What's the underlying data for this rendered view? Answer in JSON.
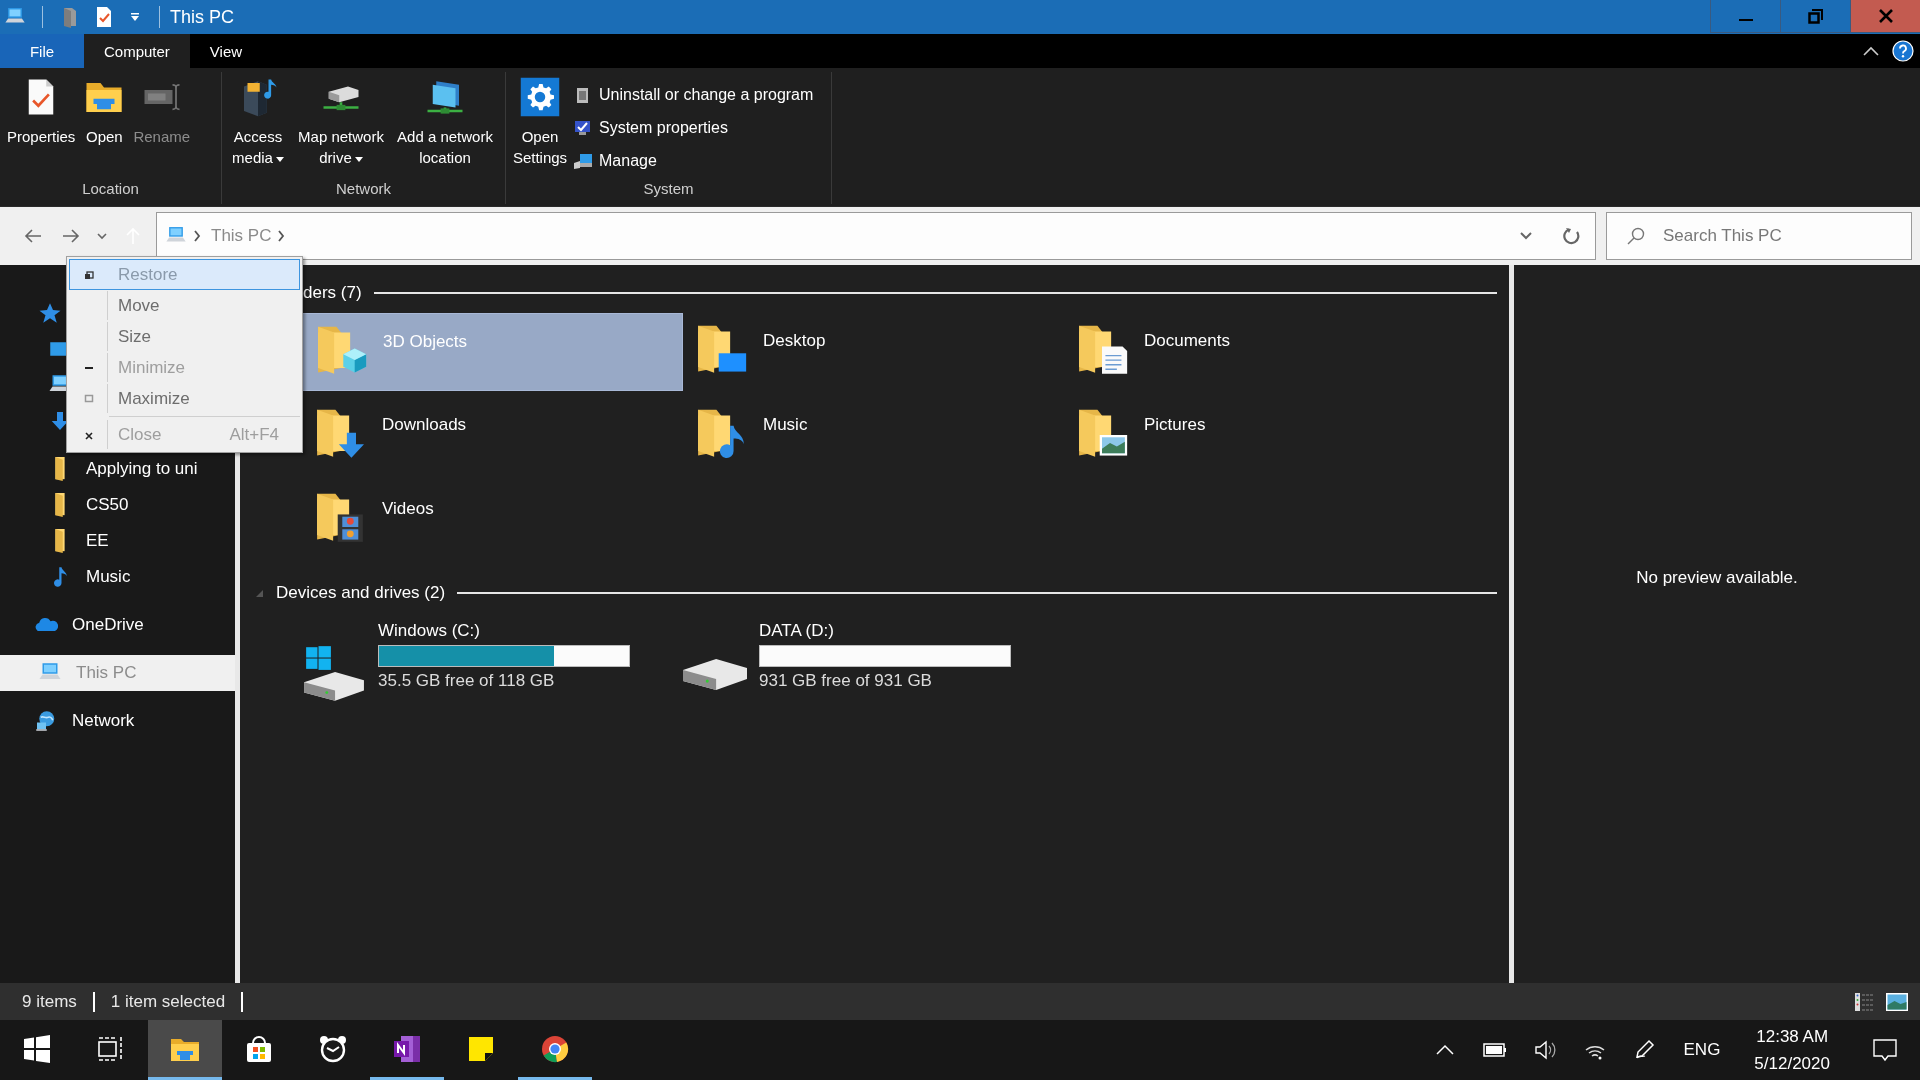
{
  "window": {
    "title": "This PC"
  },
  "ribbon_tabs": [
    {
      "label": "File",
      "kind": "file",
      "selected": false
    },
    {
      "label": "Computer",
      "kind": "tab",
      "selected": true
    },
    {
      "label": "View",
      "kind": "tab",
      "selected": false
    }
  ],
  "ribbon_groups": [
    {
      "label": "Location",
      "buttons": [
        {
          "label": "Properties",
          "kind": "large",
          "disabled": false,
          "dropdown": false
        },
        {
          "label": "Open",
          "kind": "large",
          "disabled": false,
          "dropdown": false
        },
        {
          "label": "Rename",
          "kind": "large",
          "disabled": true,
          "dropdown": false
        }
      ]
    },
    {
      "label": "Network",
      "buttons": [
        {
          "label": "Access media",
          "kind": "large",
          "disabled": false,
          "dropdown": true
        },
        {
          "label": "Map network drive",
          "kind": "large",
          "disabled": false,
          "dropdown": true
        },
        {
          "label": "Add a network location",
          "kind": "large",
          "disabled": false,
          "dropdown": false
        }
      ]
    },
    {
      "label": "System",
      "buttons": [
        {
          "label": "Open Settings",
          "kind": "large",
          "disabled": false,
          "dropdown": false
        },
        {
          "label": "Uninstall or change a program",
          "kind": "small",
          "disabled": false
        },
        {
          "label": "System properties",
          "kind": "small",
          "disabled": false
        },
        {
          "label": "Manage",
          "kind": "small",
          "disabled": false
        }
      ]
    }
  ],
  "address_bar": {
    "path": [
      "This PC"
    ],
    "search": {
      "placeholder": "Search This PC"
    }
  },
  "system_menu": [
    {
      "label": "Restore",
      "kind": "restore",
      "selected": true,
      "disabled": true
    },
    {
      "label": "Move",
      "kind": "plain",
      "selected": false,
      "disabled": false
    },
    {
      "label": "Size",
      "kind": "plain",
      "selected": false,
      "disabled": false
    },
    {
      "label": "Minimize",
      "kind": "minimize",
      "selected": false,
      "disabled": true
    },
    {
      "label": "Maximize",
      "kind": "maximize",
      "selected": false,
      "disabled": false
    },
    {
      "label": "Close",
      "kind": "close",
      "selected": false,
      "disabled": true,
      "shortcut": "Alt+F4"
    }
  ],
  "sidebar": {
    "items": [
      {
        "kind": "star",
        "selected": false
      },
      {
        "kind": "desktop",
        "selected": false
      },
      {
        "kind": "pc-small",
        "selected": false
      },
      {
        "kind": "download",
        "selected": false
      },
      {
        "label": "Applying to uni",
        "kind": "folder",
        "selected": false
      },
      {
        "label": "CS50",
        "kind": "folder",
        "selected": false
      },
      {
        "label": "EE",
        "kind": "folder",
        "selected": false
      },
      {
        "label": "Music",
        "kind": "music",
        "selected": false
      },
      {
        "label": "OneDrive",
        "kind": "onedrive",
        "selected": false
      },
      {
        "label": "This PC",
        "kind": "pc",
        "selected": true
      },
      {
        "label": "Network",
        "kind": "network",
        "selected": false
      }
    ]
  },
  "sections": [
    {
      "title": "ders (7)",
      "kind": "folders",
      "items": [
        {
          "label": "3D Objects",
          "kind": "cube",
          "selected": true
        },
        {
          "label": "Desktop",
          "kind": "desktop",
          "selected": false
        },
        {
          "label": "Documents",
          "kind": "document",
          "selected": false
        },
        {
          "label": "Downloads",
          "kind": "download",
          "selected": false
        },
        {
          "label": "Music",
          "kind": "music",
          "selected": false
        },
        {
          "label": "Pictures",
          "kind": "picture",
          "selected": false
        },
        {
          "label": "Videos",
          "kind": "video",
          "selected": false
        }
      ]
    },
    {
      "title": "Devices and drives (2)",
      "kind": "drives",
      "expanded": true,
      "items": [
        {
          "label": "Windows (C:)",
          "kind": "windows",
          "level": 0.7,
          "free": "35.5 GB free of 118 GB"
        },
        {
          "label": "DATA (D:)",
          "kind": "plain",
          "level": 0,
          "free": "931 GB free of 931 GB"
        }
      ]
    }
  ],
  "preview": {
    "message": "No preview available."
  },
  "status_bar": {
    "item_count": "9 items",
    "selection": "1 item selected"
  },
  "taskbar": {
    "apps": [
      {
        "kind": "start",
        "selected": false,
        "running": false
      },
      {
        "kind": "taskview",
        "selected": false,
        "running": false
      },
      {
        "kind": "explorer",
        "selected": true,
        "running": true
      },
      {
        "kind": "store",
        "selected": false,
        "running": false
      },
      {
        "kind": "alarm",
        "selected": false,
        "running": false
      },
      {
        "kind": "onenote",
        "selected": false,
        "running": true
      },
      {
        "kind": "sticky",
        "selected": false,
        "running": false
      },
      {
        "kind": "chrome",
        "selected": false,
        "running": true
      }
    ],
    "language": "ENG",
    "time": "12:38 AM",
    "date": "5/12/2020"
  }
}
